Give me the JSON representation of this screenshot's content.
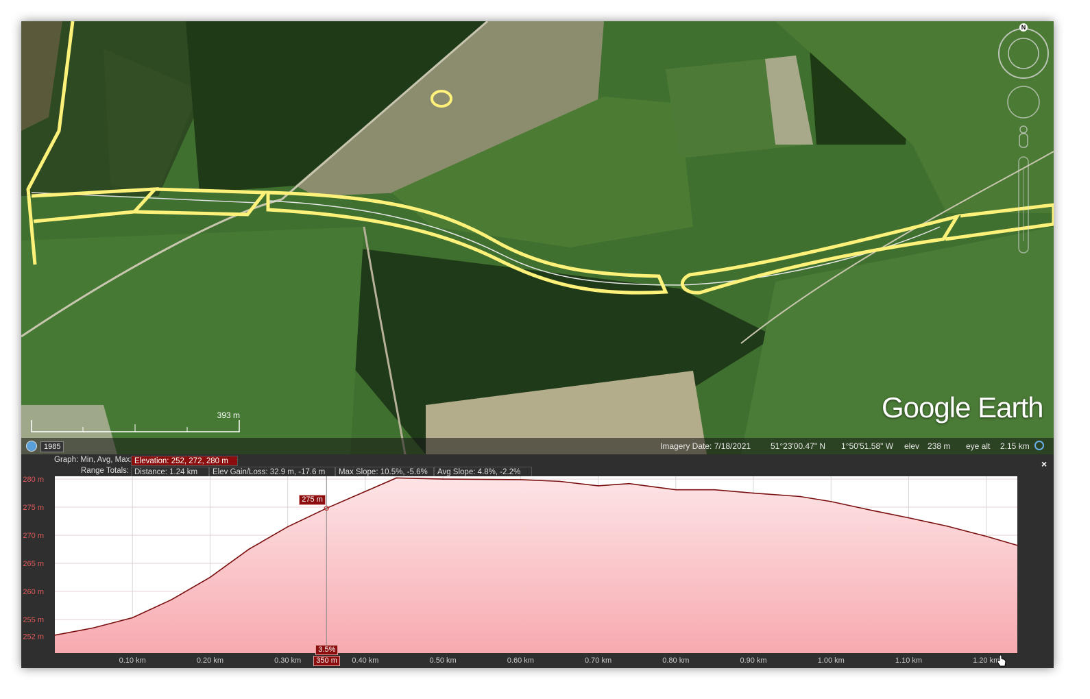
{
  "map": {
    "year_label": "1985",
    "scale_label": "393 m",
    "logo_text": "Google Earth",
    "compass_label": "N",
    "status": {
      "imagery_date": "Imagery Date: 7/18/2021",
      "lat": "51°23'00.47\" N",
      "lon": "1°50'51.58\" W",
      "elev_label": "elev",
      "elev_value": "238 m",
      "eye_label": "eye alt",
      "eye_value": "2.15 km"
    }
  },
  "profile": {
    "graph_label": "Graph: Min, Avg, Max:",
    "elevation_text": "Elevation: 252, 272, 280 m",
    "range_label": "Range Totals:",
    "distance_text": "Distance: 1.24 km",
    "gain_text": "Elev Gain/Loss: 32.9 m, -17.6 m",
    "max_slope_text": "Max Slope: 10.5%, -5.6%",
    "avg_slope_text": "Avg Slope: 4.8%, -2.2%",
    "close_label": "×",
    "cursor_elev_tag": "275 m",
    "cursor_slope_tag": "3.5%",
    "cursor_dist_tag": "350 m"
  },
  "chart_data": {
    "type": "area",
    "title": "",
    "xlabel": "",
    "ylabel": "",
    "y_ticks": [
      "280 m",
      "275 m",
      "270 m",
      "265 m",
      "260 m",
      "255 m",
      "252 m"
    ],
    "y_tick_values": [
      280,
      275,
      270,
      265,
      260,
      255,
      252
    ],
    "x_ticks": [
      "0.10 km",
      "0.20 km",
      "0.30 km",
      "0.40 km",
      "0.50 km",
      "0.60 km",
      "0.70 km",
      "0.80 km",
      "0.90 km",
      "1.00 km",
      "1.10 km",
      "1.20 km"
    ],
    "x_tick_values": [
      0.1,
      0.2,
      0.3,
      0.4,
      0.5,
      0.6,
      0.7,
      0.8,
      0.9,
      1.0,
      1.1,
      1.2
    ],
    "xlim": [
      0,
      1.24
    ],
    "ylim": [
      249,
      280.5
    ],
    "cursor_x": 0.35,
    "series": [
      {
        "color": "#7a0e0e",
        "fill": "#f7aab0",
        "x": [
          0,
          0.05,
          0.1,
          0.15,
          0.2,
          0.25,
          0.3,
          0.35,
          0.4,
          0.44,
          0.5,
          0.6,
          0.65,
          0.7,
          0.74,
          0.8,
          0.85,
          0.9,
          0.96,
          1.0,
          1.05,
          1.1,
          1.15,
          1.2,
          1.24
        ],
        "y": [
          252.2,
          253.5,
          255.3,
          258.5,
          262.5,
          267.5,
          271.5,
          274.8,
          277.8,
          280.2,
          280,
          279.9,
          279.6,
          278.8,
          279.2,
          278.1,
          278.1,
          277.5,
          276.9,
          276.0,
          274.5,
          273.1,
          271.6,
          269.8,
          268.2
        ]
      }
    ]
  }
}
